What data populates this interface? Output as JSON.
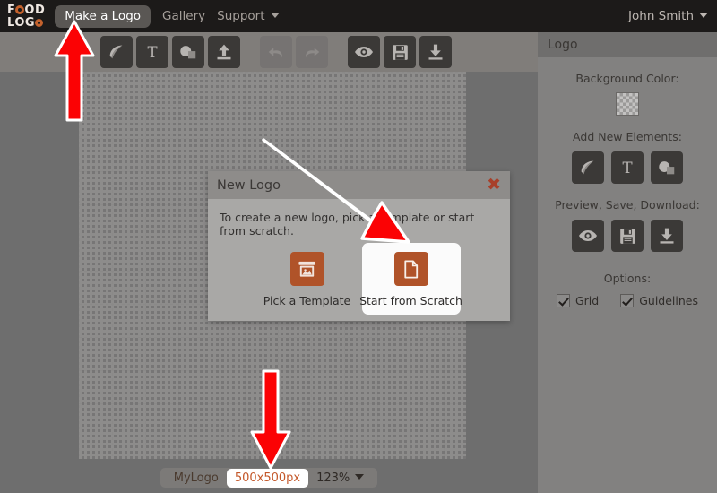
{
  "topnav": {
    "brand_line1": "F O OD",
    "brand_line2": "LOGO",
    "brand_text": "FOODLOGO",
    "make_logo_label": "Make a Logo",
    "gallery_label": "Gallery",
    "support_label": "Support",
    "user_label": "John Smith"
  },
  "toolbar": {
    "items": [
      {
        "name": "leaf-icon",
        "label": "Leaf",
        "enabled": true
      },
      {
        "name": "text-icon",
        "label": "T",
        "enabled": true
      },
      {
        "name": "shapes-icon",
        "label": "Shapes",
        "enabled": true
      },
      {
        "name": "upload-icon",
        "label": "Upload",
        "enabled": true
      },
      {
        "name": "undo-icon",
        "label": "Undo",
        "enabled": false
      },
      {
        "name": "redo-icon",
        "label": "Redo",
        "enabled": false
      },
      {
        "name": "preview-eye-icon",
        "label": "Preview",
        "enabled": true
      },
      {
        "name": "save-floppy-icon",
        "label": "Save",
        "enabled": true
      },
      {
        "name": "download-icon",
        "label": "Download",
        "enabled": true
      }
    ]
  },
  "modal": {
    "title": "New Logo",
    "close_label": "✖",
    "description": "To create a new logo, pick a template or start from scratch.",
    "choices": [
      {
        "label": "Pick a Template",
        "icon": "picture-frame-icon",
        "selected": false
      },
      {
        "label": "Start from Scratch",
        "icon": "blank-page-icon",
        "selected": true
      }
    ]
  },
  "panel": {
    "header": "Logo",
    "background_color_label": "Background Color:",
    "background_color_value": "transparent",
    "add_elements_label": "Add New Elements:",
    "add_elements": [
      {
        "name": "leaf-icon",
        "label": "Leaf"
      },
      {
        "name": "text-icon",
        "label": "T"
      },
      {
        "name": "shapes-icon",
        "label": "Shapes"
      }
    ],
    "preview_save_download_label": "Preview, Save, Download:",
    "psd_icons": [
      {
        "name": "preview-eye-icon",
        "label": "Preview"
      },
      {
        "name": "save-floppy-icon",
        "label": "Save"
      },
      {
        "name": "download-icon",
        "label": "Download"
      }
    ],
    "options_label": "Options:",
    "options": [
      {
        "label": "Grid",
        "checked": true
      },
      {
        "label": "Guidelines",
        "checked": true
      }
    ]
  },
  "bottombar": {
    "doc_name": "MyLogo",
    "canvas_size": "500x500px",
    "zoom_level": "123%"
  },
  "colors": {
    "accent_orange": "#b05329",
    "nav_background": "#1c1a19",
    "app_background": "#6e6e6e",
    "panel_background": "#828180",
    "annotation_red": "#fb0204"
  },
  "annotations": {
    "arrow_count": 3,
    "targets": [
      "make-logo-button",
      "start-from-scratch-choice",
      "canvas-size-field"
    ]
  }
}
